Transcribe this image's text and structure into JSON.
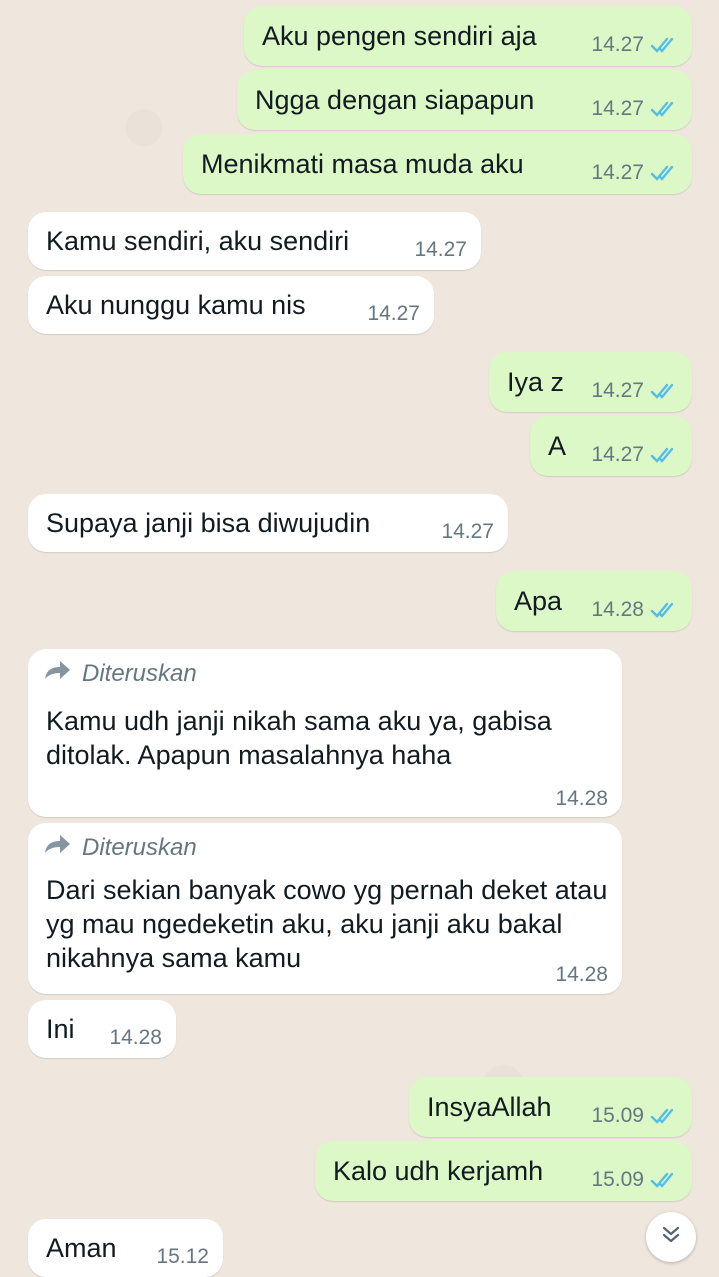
{
  "colors": {
    "wallpaper": "#efe7de",
    "outgoing_bubble": "#dbf8c6",
    "incoming_bubble": "#ffffff",
    "read_ticks": "#53bdeb",
    "meta_text": "#667781"
  },
  "messages": [
    {
      "direction": "out",
      "text": "Aku pengen sendiri aja",
      "time": "14.27",
      "status": "read"
    },
    {
      "direction": "out",
      "text": "Ngga dengan siapapun",
      "time": "14.27",
      "status": "read"
    },
    {
      "direction": "out",
      "text": "Menikmati masa muda aku",
      "time": "14.27",
      "status": "read"
    },
    {
      "direction": "in",
      "text": "Kamu sendiri, aku sendiri",
      "time": "14.27"
    },
    {
      "direction": "in",
      "text": "Aku nunggu kamu nis",
      "time": "14.27"
    },
    {
      "direction": "out",
      "text": "Iya z",
      "time": "14.27",
      "status": "read"
    },
    {
      "direction": "out",
      "text": "A",
      "time": "14.27",
      "status": "read"
    },
    {
      "direction": "in",
      "text": "Supaya janji bisa diwujudin",
      "time": "14.27"
    },
    {
      "direction": "out",
      "text": "Apa",
      "time": "14.28",
      "status": "read"
    },
    {
      "direction": "in",
      "forwarded_label": "Diteruskan",
      "text": "Kamu udh janji nikah sama aku ya, gabisa ditolak. Apapun masalahnya haha",
      "time": "14.28"
    },
    {
      "direction": "in",
      "forwarded_label": "Diteruskan",
      "text": "Dari sekian banyak cowo yg pernah deket atau yg mau ngedeketin aku, aku janji aku bakal nikahnya sama kamu",
      "time": "14.28"
    },
    {
      "direction": "in",
      "text": "Ini",
      "time": "14.28"
    },
    {
      "direction": "out",
      "text": "InsyaAllah",
      "time": "15.09",
      "status": "read"
    },
    {
      "direction": "out",
      "text": "Kalo udh kerjamh",
      "time": "15.09",
      "status": "read"
    },
    {
      "direction": "in",
      "text": "Aman",
      "time": "15.12"
    }
  ],
  "icons": {
    "read_receipt": "double-check-icon",
    "forward": "forward-arrow-icon",
    "scroll_down": "chevron-double-down-icon"
  }
}
